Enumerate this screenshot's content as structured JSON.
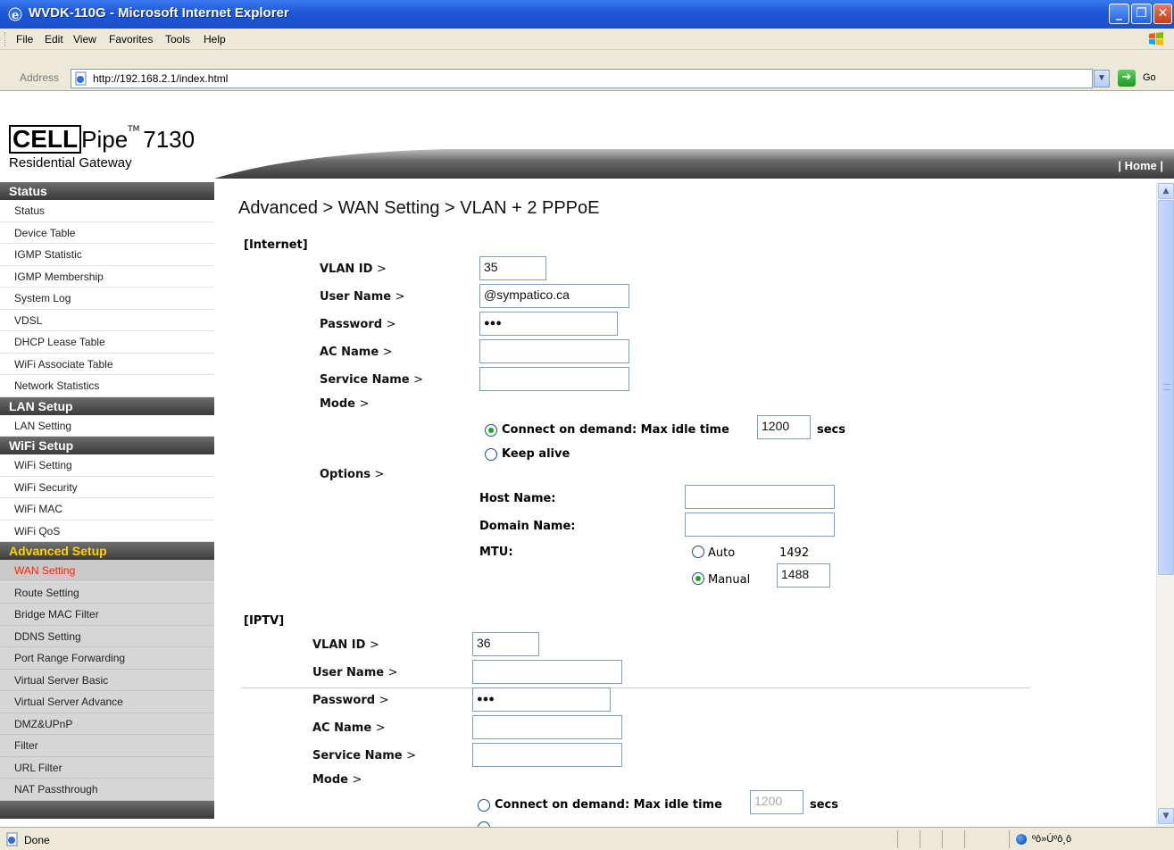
{
  "window": {
    "title": "WVDK-110G - Microsoft Internet Explorer"
  },
  "menubar": [
    "File",
    "Edit",
    "View",
    "Favorites",
    "Tools",
    "Help"
  ],
  "address": {
    "label": "Address",
    "url": "http://192.168.2.1/index.html",
    "go": "Go"
  },
  "header": {
    "logo_cell": "CELL",
    "logo_pipe": "Pipe",
    "logo_tm": "TM",
    "logo_model": "7130",
    "logo_sub": "Residential Gateway",
    "home": "| Home |"
  },
  "sidebar": {
    "status_head": "Status",
    "status_items": [
      "Status",
      "Device Table",
      "IGMP Statistic",
      "IGMP Membership",
      "System Log",
      "VDSL",
      "DHCP Lease Table",
      "WiFi Associate Table",
      "Network Statistics"
    ],
    "lan_head": "LAN Setup",
    "lan_items": [
      "LAN Setting"
    ],
    "wifi_head": "WiFi Setup",
    "wifi_items": [
      "WiFi Setting",
      "WiFi Security",
      "WiFi MAC",
      "WiFi QoS"
    ],
    "adv_head": "Advanced Setup",
    "adv_items": [
      "WAN Setting",
      "Route Setting",
      "Bridge MAC Filter",
      "DDNS Setting",
      "Port Range Forwarding",
      "Virtual Server Basic",
      "Virtual Server Advance",
      "DMZ&UPnP",
      "Filter",
      "URL Filter",
      "NAT Passthrough"
    ]
  },
  "main": {
    "breadcrumb": "Advanced > WAN Setting > VLAN + 2 PPPoE",
    "internet": {
      "section": "[Internet]",
      "vlan_label": "VLAN ID",
      "vlan_value": "35",
      "user_label": "User Name",
      "user_value": "@sympatico.ca",
      "pass_label": "Password",
      "pass_value": "●●●",
      "ac_label": "AC Name",
      "ac_value": "",
      "svc_label": "Service Name",
      "svc_value": "",
      "mode_label": "Mode",
      "demand_label": "Connect on demand: Max idle time",
      "idle_value": "1200",
      "secs": "secs",
      "keepalive_label": "Keep alive",
      "options_label": "Options",
      "host_label": "Host Name:",
      "host_value": "",
      "domain_label": "Domain Name:",
      "domain_value": "",
      "mtu_label": "MTU:",
      "mtu_auto": "Auto",
      "mtu_auto_value": "1492",
      "mtu_manual": "Manual",
      "mtu_manual_value": "1488"
    },
    "iptv": {
      "section": "[IPTV]",
      "vlan_label": "VLAN ID",
      "vlan_value": "36",
      "user_label": "User Name",
      "user_value": "",
      "pass_label": "Password",
      "pass_value": "●●●",
      "ac_label": "AC Name",
      "ac_value": "",
      "svc_label": "Service Name",
      "svc_value": "",
      "mode_label": "Mode",
      "demand_label": "Connect on demand: Max idle time",
      "idle_value": "1200",
      "secs": "secs"
    },
    "gt": ">"
  },
  "statusbar": {
    "text": "Done",
    "zone": "ºô»Úºô¸ô"
  }
}
